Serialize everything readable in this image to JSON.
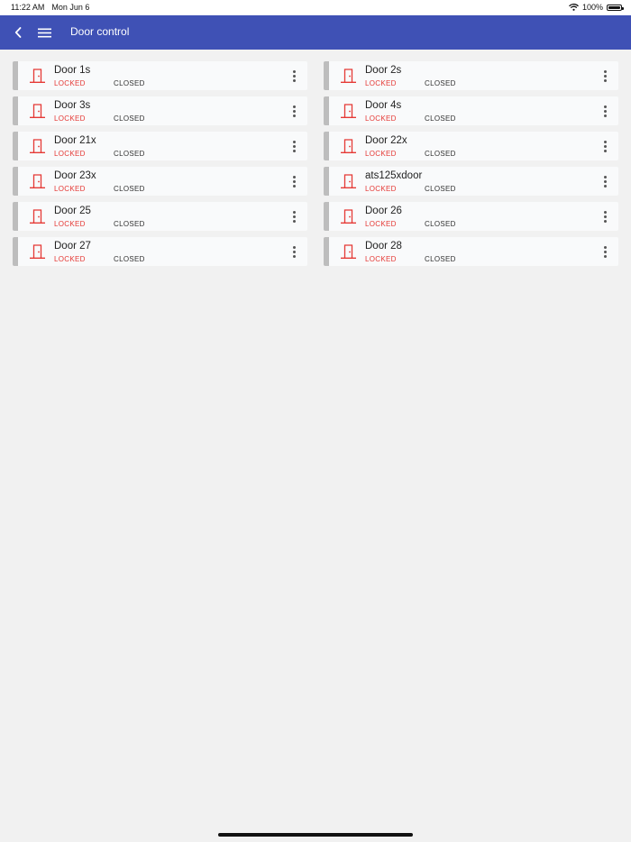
{
  "status_bar": {
    "time": "11:22 AM",
    "date": "Mon Jun 6",
    "battery_percent": "100%",
    "battery_level": 1.0,
    "wifi_icon": "wifi-icon"
  },
  "app_bar": {
    "title": "Door control",
    "back_icon": "back-chevron-icon",
    "menu_icon": "hamburger-menu-icon",
    "color": "#3f51b5"
  },
  "colors": {
    "locked": "#e53935",
    "door_icon": "#e53935",
    "card_accent": "#bdbdbd"
  },
  "doors": [
    {
      "name": "Door 1s",
      "lock": "LOCKED",
      "state": "CLOSED"
    },
    {
      "name": "Door 2s",
      "lock": "LOCKED",
      "state": "CLOSED"
    },
    {
      "name": "Door 3s",
      "lock": "LOCKED",
      "state": "CLOSED"
    },
    {
      "name": "Door 4s",
      "lock": "LOCKED",
      "state": "CLOSED"
    },
    {
      "name": "Door 21x",
      "lock": "LOCKED",
      "state": "CLOSED"
    },
    {
      "name": "Door 22x",
      "lock": "LOCKED",
      "state": "CLOSED"
    },
    {
      "name": "Door 23x",
      "lock": "LOCKED",
      "state": "CLOSED"
    },
    {
      "name": "ats125xdoor",
      "lock": "LOCKED",
      "state": "CLOSED"
    },
    {
      "name": "Door 25",
      "lock": "LOCKED",
      "state": "CLOSED"
    },
    {
      "name": "Door 26",
      "lock": "LOCKED",
      "state": "CLOSED"
    },
    {
      "name": "Door 27",
      "lock": "LOCKED",
      "state": "CLOSED"
    },
    {
      "name": "Door 28",
      "lock": "LOCKED",
      "state": "CLOSED"
    }
  ]
}
